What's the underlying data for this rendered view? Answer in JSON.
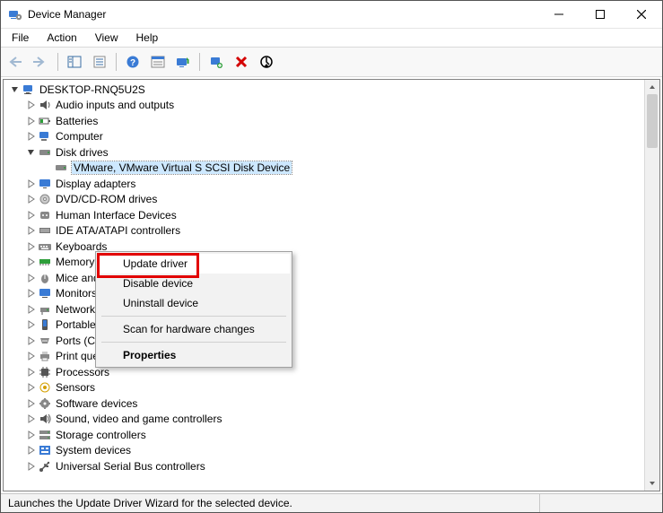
{
  "window": {
    "title": "Device Manager"
  },
  "menubar": {
    "items": [
      "File",
      "Action",
      "View",
      "Help"
    ]
  },
  "toolbar": {
    "buttons": [
      {
        "name": "back-button",
        "label": "Back",
        "enabled": false
      },
      {
        "name": "forward-button",
        "label": "Forward",
        "enabled": false
      },
      {
        "sep": true
      },
      {
        "name": "show-hide-tree-button",
        "label": "Show/Hide Console Tree",
        "enabled": true
      },
      {
        "name": "properties-button",
        "label": "Properties",
        "enabled": true
      },
      {
        "sep": true
      },
      {
        "name": "help-button",
        "label": "Help",
        "enabled": true
      },
      {
        "name": "view-button",
        "label": "View",
        "enabled": true
      },
      {
        "name": "update-driver-button",
        "label": "Update Driver",
        "enabled": true
      },
      {
        "sep": true
      },
      {
        "name": "scan-hardware-button",
        "label": "Scan for hardware changes",
        "enabled": true
      },
      {
        "name": "uninstall-button",
        "label": "Uninstall device",
        "enabled": true
      },
      {
        "name": "disable-button",
        "label": "Disable device",
        "enabled": true
      }
    ]
  },
  "tree": {
    "root": {
      "label": "DESKTOP-RNQ5U2S",
      "iconHint": "computer-icon",
      "expanded": true,
      "children": [
        {
          "label": "Audio inputs and outputs",
          "iconHint": "audio-icon",
          "hasChildren": true
        },
        {
          "label": "Batteries",
          "iconHint": "battery-icon",
          "hasChildren": true
        },
        {
          "label": "Computer",
          "iconHint": "computer-small-icon",
          "hasChildren": true
        },
        {
          "label": "Disk drives",
          "iconHint": "disk-icon",
          "hasChildren": true,
          "expanded": true,
          "children": [
            {
              "label": "VMware, VMware Virtual S SCSI Disk Device",
              "iconHint": "disk-icon",
              "selected": true
            }
          ]
        },
        {
          "label": "Display adapters",
          "iconHint": "display-icon",
          "hasChildren": true
        },
        {
          "label": "DVD/CD-ROM drives",
          "iconHint": "dvd-icon",
          "hasChildren": true
        },
        {
          "label": "Human Interface Devices",
          "iconHint": "hid-icon",
          "hasChildren": true
        },
        {
          "label": "IDE ATA/ATAPI controllers",
          "iconHint": "ide-icon",
          "hasChildren": true
        },
        {
          "label": "Keyboards",
          "iconHint": "keyboard-icon",
          "hasChildren": true
        },
        {
          "label": "Memory technology devices",
          "iconHint": "memory-icon",
          "hasChildren": true
        },
        {
          "label": "Mice and other pointing devices",
          "iconHint": "mouse-icon",
          "hasChildren": true
        },
        {
          "label": "Monitors",
          "iconHint": "monitor-icon",
          "hasChildren": true
        },
        {
          "label": "Network adapters",
          "iconHint": "network-icon",
          "hasChildren": true
        },
        {
          "label": "Portable Devices",
          "iconHint": "portable-icon",
          "hasChildren": true
        },
        {
          "label": "Ports (COM & LPT)",
          "iconHint": "port-icon",
          "hasChildren": true
        },
        {
          "label": "Print queues",
          "iconHint": "printer-icon",
          "hasChildren": true
        },
        {
          "label": "Processors",
          "iconHint": "processor-icon",
          "hasChildren": true
        },
        {
          "label": "Sensors",
          "iconHint": "sensor-icon",
          "hasChildren": true
        },
        {
          "label": "Software devices",
          "iconHint": "software-icon",
          "hasChildren": true
        },
        {
          "label": "Sound, video and game controllers",
          "iconHint": "sound-icon",
          "hasChildren": true
        },
        {
          "label": "Storage controllers",
          "iconHint": "storage-icon",
          "hasChildren": true
        },
        {
          "label": "System devices",
          "iconHint": "system-icon",
          "hasChildren": true
        },
        {
          "label": "Universal Serial Bus controllers",
          "iconHint": "usb-icon",
          "hasChildren": true
        }
      ]
    }
  },
  "contextMenu": {
    "items": [
      {
        "label": "Update driver",
        "highlight": true,
        "redBox": true
      },
      {
        "label": "Disable device"
      },
      {
        "label": "Uninstall device"
      },
      {
        "sep": true
      },
      {
        "label": "Scan for hardware changes"
      },
      {
        "sep": true
      },
      {
        "label": "Properties",
        "bold": true
      }
    ]
  },
  "status": {
    "text": "Launches the Update Driver Wizard for the selected device."
  }
}
